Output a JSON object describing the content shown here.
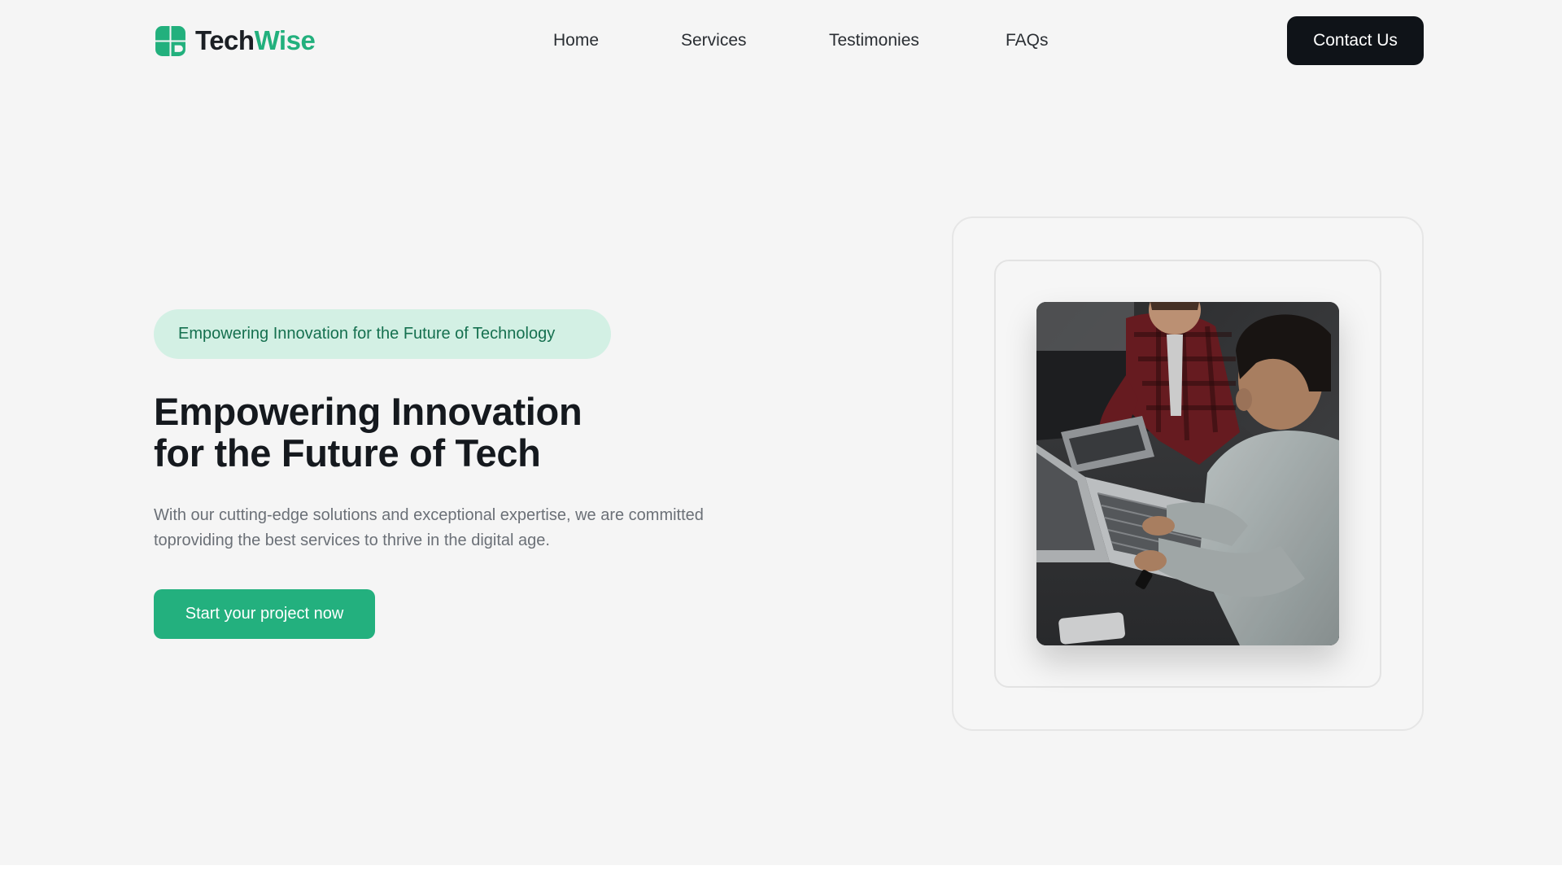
{
  "brand": {
    "name_part1": "Tech",
    "name_part2": "Wise",
    "accent_color": "#22b07d",
    "icon": "logo-mark-icon"
  },
  "nav": {
    "items": [
      "Home",
      "Services",
      "Testimonies",
      "FAQs"
    ]
  },
  "header": {
    "contact_label": "Contact Us"
  },
  "hero": {
    "eyebrow": "Empowering Innovation for the Future of Technology",
    "title_line1": "Empowering Innovation",
    "title_line2": "for the Future of Tech",
    "description": "With our cutting-edge solutions and exceptional expertise, we are committed toproviding the best services to thrive in the digital age.",
    "cta_label": "Start your project now",
    "image": "photo of two people working on laptops at a table"
  },
  "colors": {
    "background": "#f5f5f5",
    "dark_button": "#0f1318",
    "cta": "#23b07e",
    "eyebrow_bg": "#d3f0e4"
  }
}
